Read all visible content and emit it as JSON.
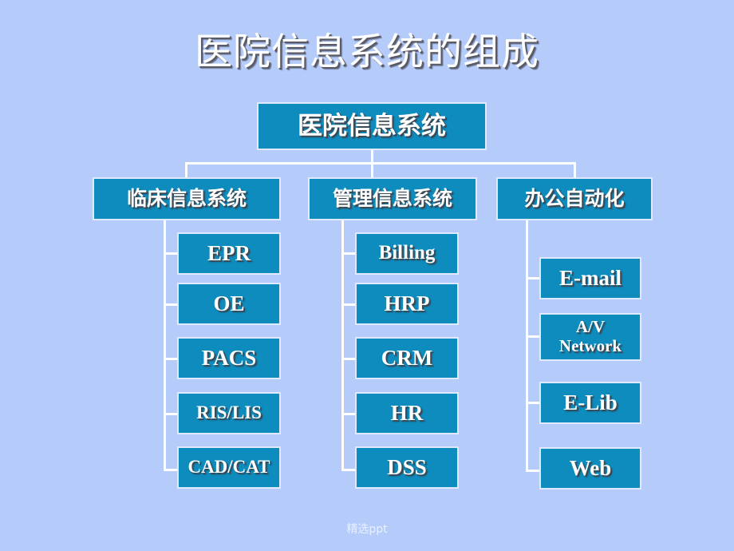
{
  "slide": {
    "title": "医院信息系统的组成",
    "footer": "精选ppt",
    "background_color": "#b5ccfb",
    "node_fill_color": "#0f8cbe",
    "node_border_color": "#dfe9ff",
    "node_text_color": "#ffffff",
    "connector_color": "#ffffff",
    "title_text_color": "#ffffff"
  },
  "diagram": {
    "root": {
      "label": "医院信息系统"
    },
    "branches": [
      {
        "label": "临床信息系统",
        "children": [
          {
            "label": "EPR"
          },
          {
            "label": "OE"
          },
          {
            "label": "PACS"
          },
          {
            "label": "RIS/LIS"
          },
          {
            "label": "CAD/CAT"
          }
        ]
      },
      {
        "label": "管理信息系统",
        "children": [
          {
            "label": "Billing"
          },
          {
            "label": "HRP"
          },
          {
            "label": "CRM"
          },
          {
            "label": "HR"
          },
          {
            "label": "DSS"
          }
        ]
      },
      {
        "label": "办公自动化",
        "children": [
          {
            "label": "E-mail"
          },
          {
            "label": "A/V",
            "label2": "Network"
          },
          {
            "label": "E-Lib"
          },
          {
            "label": "Web"
          }
        ]
      }
    ]
  }
}
